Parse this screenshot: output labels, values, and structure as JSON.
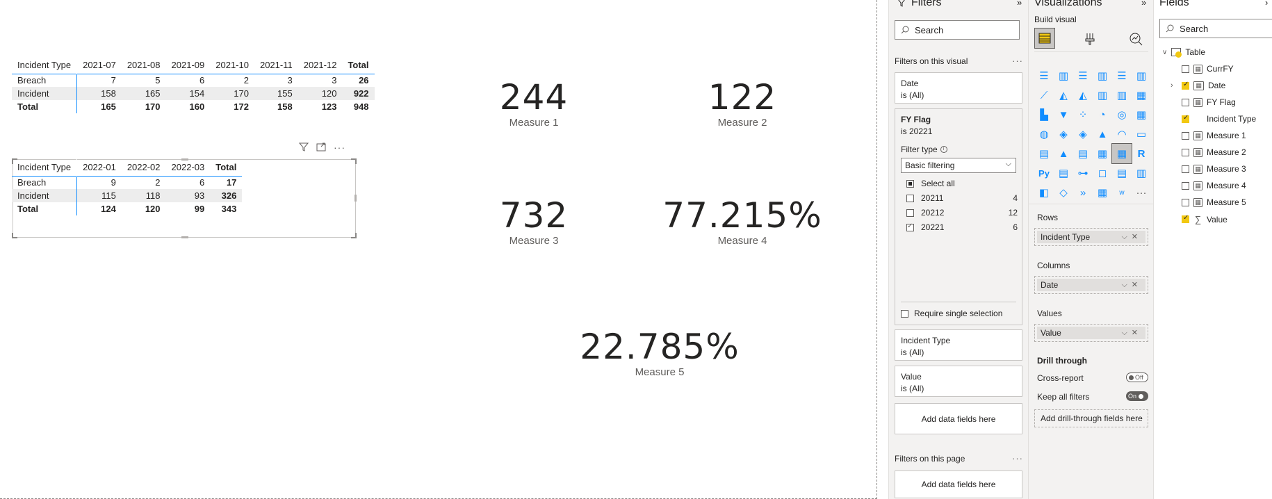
{
  "matrix1": {
    "headers": [
      "Incident Type",
      "2021-07",
      "2021-08",
      "2021-09",
      "2021-10",
      "2021-11",
      "2021-12",
      "Total"
    ],
    "rows": [
      [
        "Breach",
        "7",
        "5",
        "6",
        "2",
        "3",
        "3",
        "26"
      ],
      [
        "Incident",
        "158",
        "165",
        "154",
        "170",
        "155",
        "120",
        "922"
      ]
    ],
    "total": [
      "Total",
      "165",
      "170",
      "160",
      "172",
      "158",
      "123",
      "948"
    ]
  },
  "matrix2": {
    "headers": [
      "Incident Type",
      "2022-01",
      "2022-02",
      "2022-03",
      "Total"
    ],
    "rows": [
      [
        "Breach",
        "9",
        "2",
        "6",
        "17"
      ],
      [
        "Incident",
        "115",
        "118",
        "93",
        "326"
      ]
    ],
    "total": [
      "Total",
      "124",
      "120",
      "99",
      "343"
    ],
    "header_icons": [
      "filter-icon",
      "focus-mode-icon",
      "more-options-icon"
    ]
  },
  "cards": [
    {
      "value": "244",
      "label": "Measure 1"
    },
    {
      "value": "122",
      "label": "Measure 2"
    },
    {
      "value": "732",
      "label": "Measure 3"
    },
    {
      "value": "77.215%",
      "label": "Measure 4"
    },
    {
      "value": "22.785%",
      "label": "Measure 5"
    }
  ],
  "filters": {
    "title": "Filters",
    "search_placeholder": "Search",
    "on_visual_label": "Filters on this visual",
    "date": {
      "title": "Date",
      "state": "is (All)"
    },
    "fy_flag": {
      "title": "FY Flag",
      "state": "is 20221",
      "filter_type_label": "Filter type",
      "filter_type_value": "Basic filtering",
      "select_all": "Select all",
      "items": [
        {
          "label": "20211",
          "count": "4"
        },
        {
          "label": "20212",
          "count": "12"
        },
        {
          "label": "20221",
          "count": "6"
        }
      ],
      "require_single": "Require single selection"
    },
    "incident_type": {
      "title": "Incident Type",
      "state": "is (All)"
    },
    "value": {
      "title": "Value",
      "state": "is (All)"
    },
    "add_fields": "Add data fields here",
    "on_page_label": "Filters on this page",
    "add_fields_page": "Add data fields here"
  },
  "visualizations": {
    "title": "Visualizations",
    "build_visual": "Build visual",
    "rows_label": "Rows",
    "rows_field": "Incident Type",
    "columns_label": "Columns",
    "columns_field": "Date",
    "values_label": "Values",
    "values_field": "Value",
    "drill_through": "Drill through",
    "cross_report": "Cross-report",
    "cross_report_state": "Off",
    "keep_all_filters": "Keep all filters",
    "keep_all_state": "On",
    "add_drill": "Add drill-through fields here"
  },
  "fields": {
    "title": "Fields",
    "search_placeholder": "Search",
    "table_name": "Table",
    "items": [
      {
        "label": "CurrFY",
        "checked": false
      },
      {
        "label": "Date",
        "checked": true
      },
      {
        "label": "FY Flag",
        "checked": false
      },
      {
        "label": "Incident Type",
        "checked": true
      },
      {
        "label": "Measure 1",
        "checked": false
      },
      {
        "label": "Measure 2",
        "checked": false
      },
      {
        "label": "Measure 3",
        "checked": false
      },
      {
        "label": "Measure 4",
        "checked": false
      },
      {
        "label": "Measure 5",
        "checked": false
      },
      {
        "label": "Value",
        "checked": true
      }
    ]
  },
  "colors": {
    "accent": "#118dff",
    "check_yellow": "#f2c811",
    "pane_bg": "#f3f2f1"
  }
}
